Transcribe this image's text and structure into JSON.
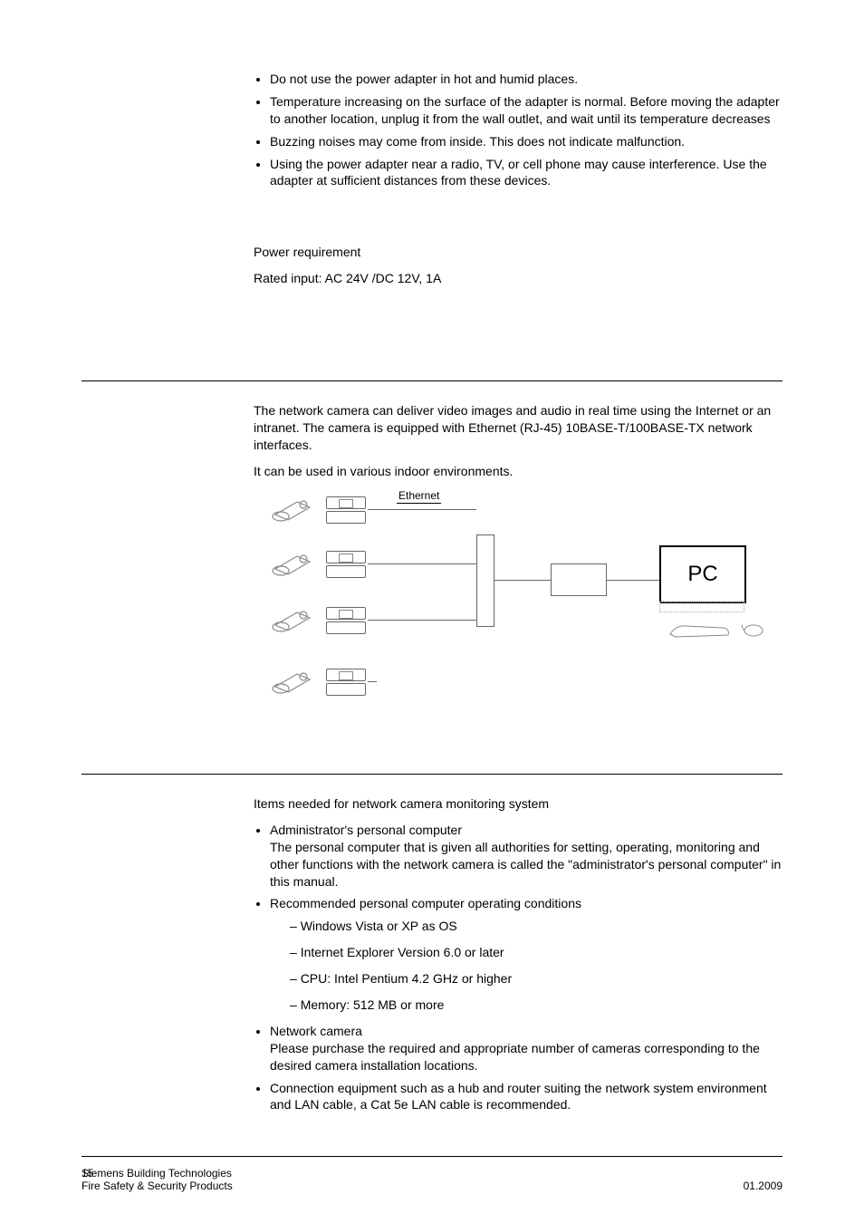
{
  "bullets_top": [
    "Do not use the power adapter in hot and humid places.",
    "Temperature increasing on the surface of the adapter is normal. Before moving the adapter to another location, unplug it from the wall outlet, and wait until its temperature decreases",
    "Buzzing noises may come from inside. This does not indicate malfunction.",
    "Using the power adapter near a radio, TV, or cell phone may cause interference. Use the adapter at sufficient distances from these devices."
  ],
  "power": {
    "heading": "Power requirement",
    "value": "Rated input: AC 24V /DC 12V, 1A"
  },
  "overview": {
    "p1": "The network camera can deliver video images and audio in real time using the Internet or an intranet. The camera is equipped with Ethernet (RJ-45) 10BASE-T/100BASE-TX network interfaces.",
    "p2": "It can be used in various indoor environments."
  },
  "diagram": {
    "ethernet_label": "Ethernet",
    "pc_label": "PC"
  },
  "items_heading": "Items needed for network camera monitoring system",
  "items": [
    {
      "title": "Administrator's personal computer",
      "body": "The personal computer that is given all authorities for setting, operating, monitoring and other functions with the network camera is called the \"administrator's personal computer\" in this manual."
    },
    {
      "title": "Recommended personal computer operating conditions",
      "sub": [
        "Windows Vista or XP as OS",
        "Internet Explorer Version 6.0 or later",
        "CPU: Intel Pentium 4.2 GHz or higher",
        "Memory: 512 MB or more"
      ]
    },
    {
      "title": "Network camera",
      "body": "Please purchase the required and appropriate number of cameras corresponding to the desired camera installation locations."
    },
    {
      "title_only": "Connection equipment such as a hub and router suiting the network system environment and LAN cable, a Cat 5e LAN cable is recommended."
    }
  ],
  "footer": {
    "page": "15",
    "left1": "Siemens Building Technologies",
    "left2": "Fire Safety & Security Products",
    "right2": "01.2009"
  }
}
